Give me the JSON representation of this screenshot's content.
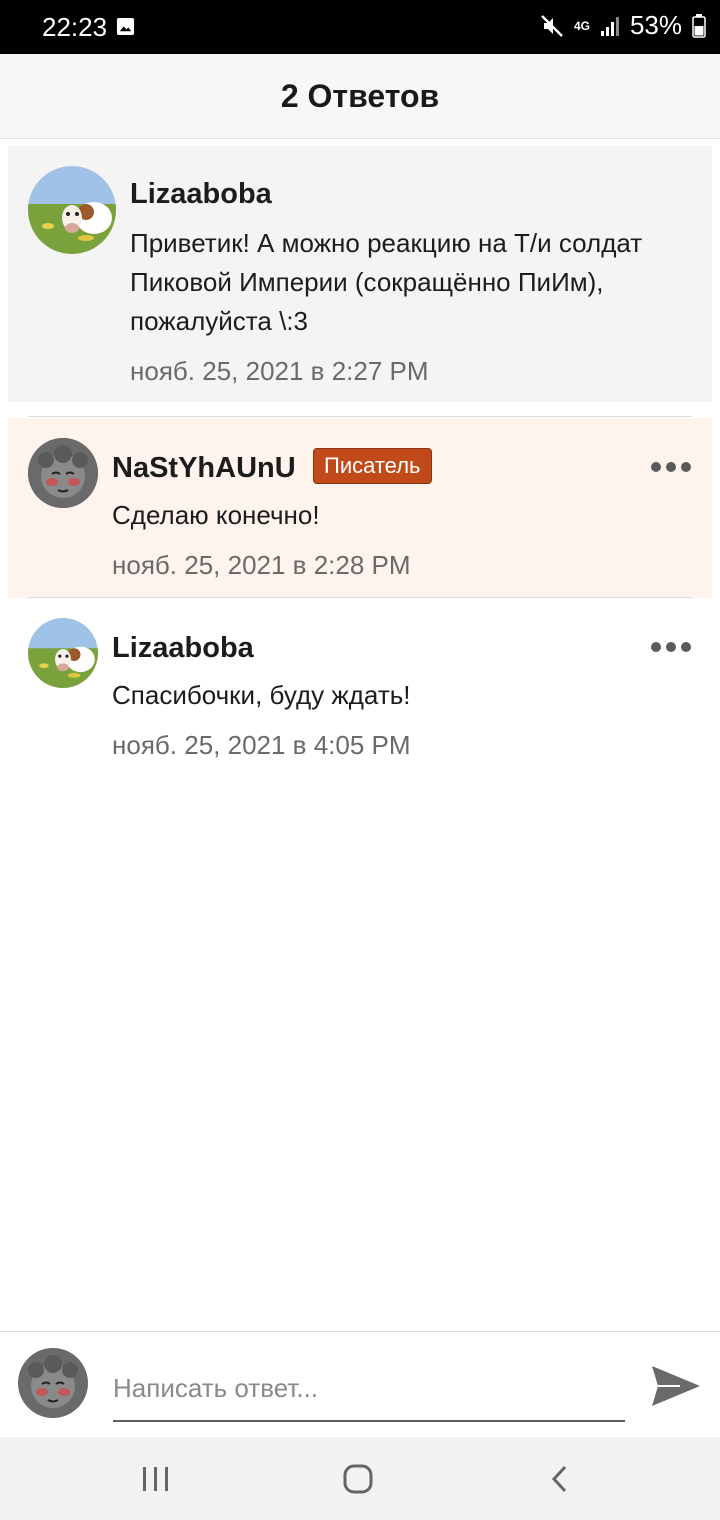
{
  "status": {
    "time": "22:23",
    "network": "4G",
    "battery": "53%"
  },
  "header": {
    "title": "2 Ответов"
  },
  "comments": [
    {
      "user": "Lizaaboba",
      "text": "Приветик! А можно реакцию на Т/и солдат Пиковой Империи (сокращённо ПиИм), пожалуйста \\:3",
      "time": "нояб. 25, 2021 в 2:27 PM"
    },
    {
      "user": "NaStYhAUnU",
      "badge": "Писатель",
      "text": "Сделаю конечно!",
      "time": "нояб. 25, 2021 в 2:28 PM"
    },
    {
      "user": "Lizaaboba",
      "text": "Спасибочки, буду ждать!",
      "time": "нояб. 25, 2021 в 4:05 PM"
    }
  ],
  "composer": {
    "placeholder": "Написать ответ..."
  },
  "colors": {
    "badge": "#c14a1a",
    "highlight_bg": "#fff3ee",
    "parent_bg": "#f4f4f4"
  },
  "icons": [
    "image-icon",
    "mute-icon",
    "signal-icon",
    "battery-icon",
    "more-icon",
    "send-icon",
    "recents-icon",
    "home-icon",
    "back-icon"
  ]
}
